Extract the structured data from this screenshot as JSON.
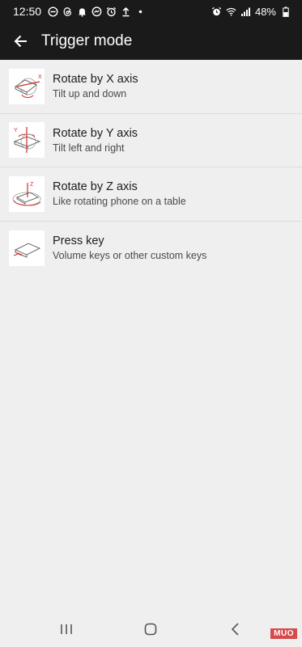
{
  "status_bar": {
    "time": "12:50",
    "left_icons": [
      "do-not-disturb-icon",
      "threads-icon",
      "bell-icon",
      "messenger-icon",
      "alarm-icon",
      "upload-icon",
      "dot-icon"
    ],
    "right_icons": [
      "alarm-icon",
      "wifi-icon",
      "signal-icon"
    ],
    "battery": "48%"
  },
  "toolbar": {
    "back_icon": "arrow-left-icon",
    "title": "Trigger mode"
  },
  "items": [
    {
      "title": "Rotate by X axis",
      "subtitle": "Tilt up and down",
      "icon": "rotate-x-icon"
    },
    {
      "title": "Rotate by Y axis",
      "subtitle": "Tilt left and right",
      "icon": "rotate-y-icon"
    },
    {
      "title": "Rotate by Z axis",
      "subtitle": "Like rotating phone on a table",
      "icon": "rotate-z-icon"
    },
    {
      "title": "Press key",
      "subtitle": "Volume keys or other custom keys",
      "icon": "press-key-icon"
    }
  ],
  "nav_bar": {
    "icons": [
      "recents-icon",
      "home-icon",
      "back-icon"
    ]
  },
  "watermark": "MUO",
  "colors": {
    "header_bg": "#1a1a1a",
    "page_bg": "#efefef",
    "accent_red": "#d22b2b"
  }
}
